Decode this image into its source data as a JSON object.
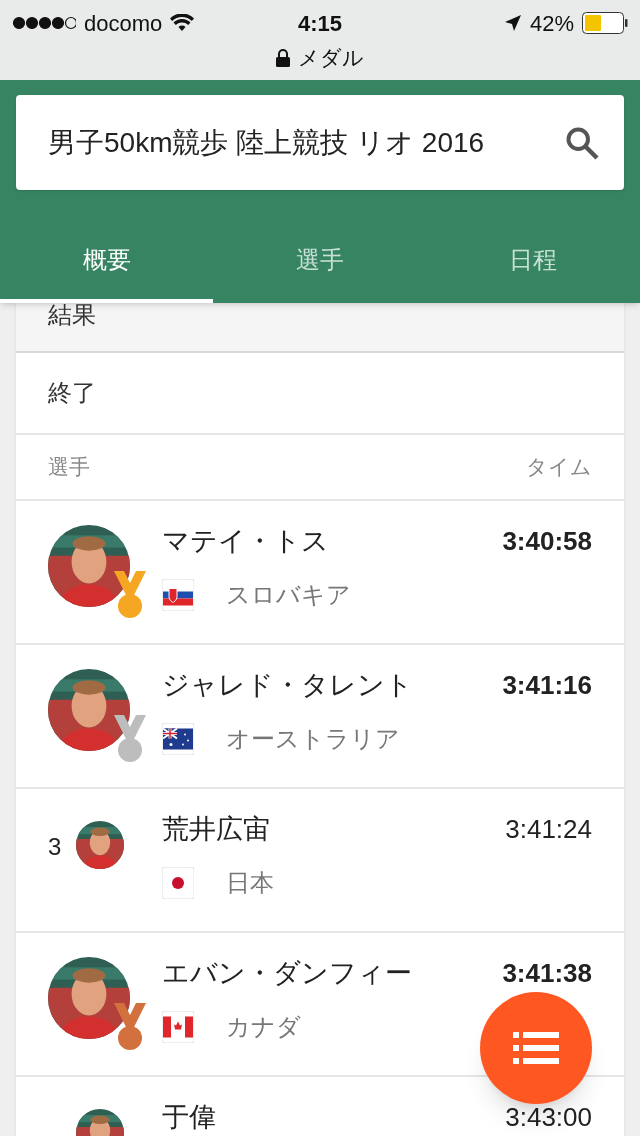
{
  "status_bar": {
    "carrier": "docomo",
    "time": "4:15",
    "battery": "42%",
    "page_title": "メダル"
  },
  "search": {
    "value": "男子50km競歩 陸上競技 リオ 2016"
  },
  "tabs": [
    {
      "label": "概要",
      "selected": true
    },
    {
      "label": "選手",
      "selected": false
    },
    {
      "label": "日程",
      "selected": false
    }
  ],
  "section_title": "結果",
  "event_status": "終了",
  "columns": [
    "選手",
    "タイム"
  ],
  "rows": [
    {
      "kind": "gold",
      "name": "マテイ・トス",
      "country": "スロバキア",
      "flag": {
        "kind": "sk"
      },
      "time": "3:40:58"
    },
    {
      "kind": "silver",
      "name": "ジャレド・タレント",
      "country": "オーストラリア",
      "flag": {
        "kind": "au"
      },
      "time": "3:41:16"
    },
    {
      "kind": "ranked",
      "rank": "3",
      "name": "荒井広宙",
      "country": "日本",
      "flag": {
        "kind": "jp"
      },
      "time": "3:41:24"
    },
    {
      "kind": "bronze",
      "name": "エバン・ダンフィー",
      "country": "カナダ",
      "flag": {
        "kind": "ca"
      },
      "time": "3:41:38"
    },
    {
      "kind": "ranked",
      "name": "于偉",
      "time": "3:43:00"
    }
  ]
}
